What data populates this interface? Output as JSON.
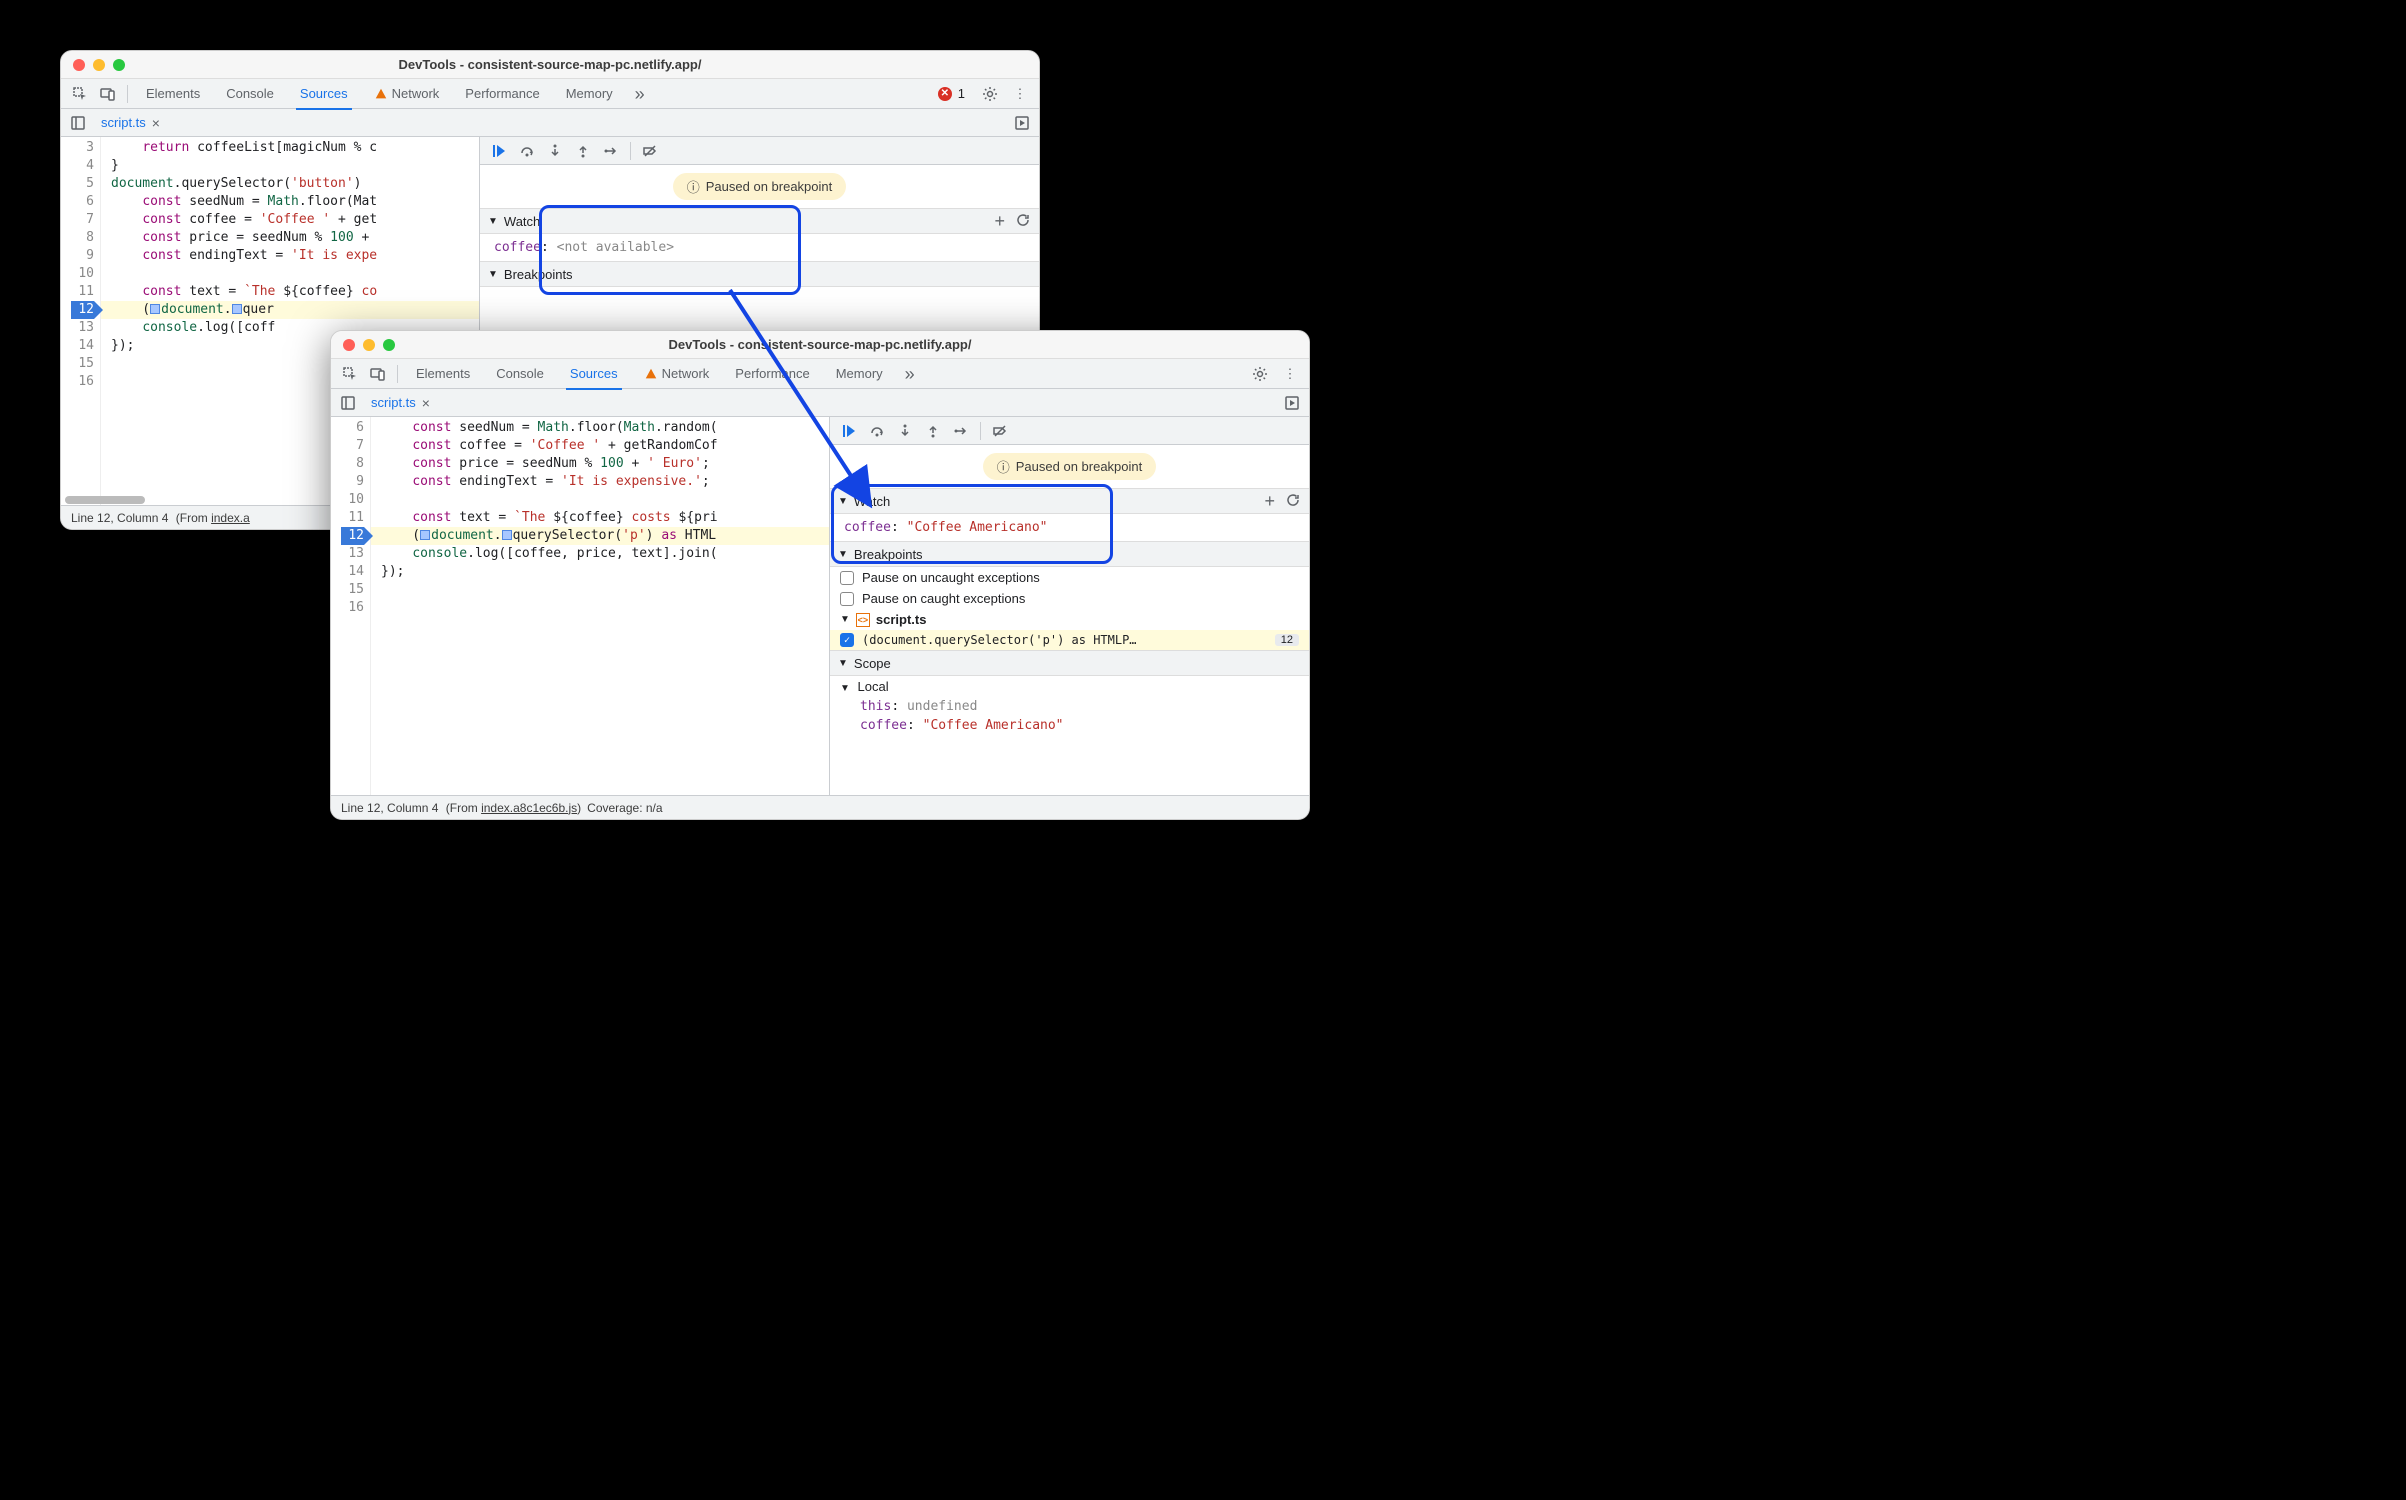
{
  "window_title": "DevTools - consistent-source-map-pc.netlify.app/",
  "tabs": {
    "elements": "Elements",
    "console": "Console",
    "sources": "Sources",
    "network": "Network",
    "performance": "Performance",
    "memory": "Memory"
  },
  "error_count": "1",
  "file_tab": "script.ts",
  "paused_label": "Paused on breakpoint",
  "sections": {
    "watch": "Watch",
    "breakpoints": "Breakpoints",
    "scope": "Scope"
  },
  "win1": {
    "gutter": [
      "3",
      "4",
      "5",
      "6",
      "7",
      "8",
      "9",
      "10",
      "11",
      "12",
      "13",
      "14",
      "15",
      "16"
    ],
    "watch": {
      "key": "coffee",
      "val": "<not available>"
    },
    "status": {
      "line": "Line 12, Column 4",
      "from_prefix": "(From ",
      "from_file": "index.a"
    }
  },
  "win2": {
    "gutter": [
      "6",
      "7",
      "8",
      "9",
      "10",
      "11",
      "12",
      "13",
      "14",
      "15",
      "16"
    ],
    "watch": {
      "key": "coffee",
      "val": "\"Coffee Americano\""
    },
    "bp": {
      "uncaught": "Pause on uncaught exceptions",
      "caught": "Pause on caught exceptions",
      "file": "script.ts",
      "entry": "(document.querySelector('p') as HTMLP…",
      "linebadge": "12"
    },
    "scope": {
      "local": "Local",
      "this_key": "this",
      "this_val": "undefined",
      "coffee_key": "coffee",
      "coffee_val": "\"Coffee Americano\""
    },
    "status": {
      "line": "Line 12, Column 4",
      "from_prefix": "(From ",
      "from_file": "index.a8c1ec6b.js",
      "from_suffix": ")",
      "coverage": "Coverage: n/a"
    }
  },
  "code_tokens": {
    "return": "return",
    "const": "const",
    "as": "as",
    "document": "document",
    "querySelector": "querySelector",
    "Math": "Math",
    "floor": "floor",
    "random": "random",
    "console": "console",
    "log": "log"
  }
}
